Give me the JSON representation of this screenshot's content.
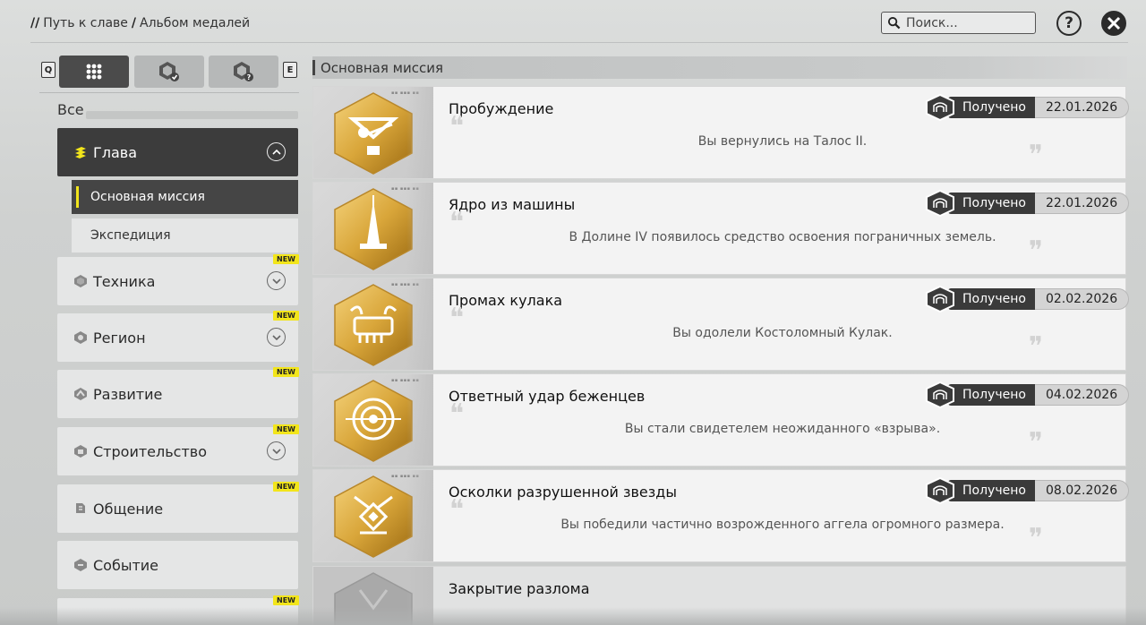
{
  "breadcrumb": {
    "sep1": "//",
    "item1": "Путь к славе",
    "sep2": "/",
    "item2": "Альбом медалей"
  },
  "search": {
    "placeholder": "Поиск..."
  },
  "help_label": "?",
  "tabs": {
    "key_left": "Q",
    "key_right": "E"
  },
  "filter_all": "Все",
  "categories": [
    {
      "label": "Глава",
      "expanded": true,
      "new": false
    },
    {
      "label": "Техника",
      "new": true
    },
    {
      "label": "Регион",
      "new": true
    },
    {
      "label": "Развитие",
      "new": true
    },
    {
      "label": "Строительство",
      "new": true
    },
    {
      "label": "Общение",
      "new": true
    },
    {
      "label": "Событие",
      "new": false
    },
    {
      "label": "",
      "new": true
    }
  ],
  "subcategories": [
    "Основная миссия",
    "Экспедиция"
  ],
  "new_badge": "NEW",
  "section_title": "Основная миссия",
  "status_label": "Получено",
  "medals": [
    {
      "title": "Пробуждение",
      "desc": "Вы вернулись на Талос II.",
      "date": "22.01.2026"
    },
    {
      "title": "Ядро из машины",
      "desc": "В Долине IV появилось средство освоения пограничных земель.",
      "date": "22.01.2026"
    },
    {
      "title": "Промах кулака",
      "desc": "Вы одолели Костоломный Кулак.",
      "date": "02.02.2026"
    },
    {
      "title": "Ответный удар беженцев",
      "desc": "Вы стали свидетелем неожиданного «взрыва».",
      "date": "04.02.2026"
    },
    {
      "title": "Осколки разрушенной звезды",
      "desc": "Вы победили частично возрожденного аггела огромного размера.",
      "date": "08.02.2026"
    },
    {
      "title": "Закрытие разлома"
    }
  ],
  "colors": {
    "accent_yellow": "#f2e51b",
    "dark": "#3c3c3c",
    "gold": "#c9952a"
  }
}
